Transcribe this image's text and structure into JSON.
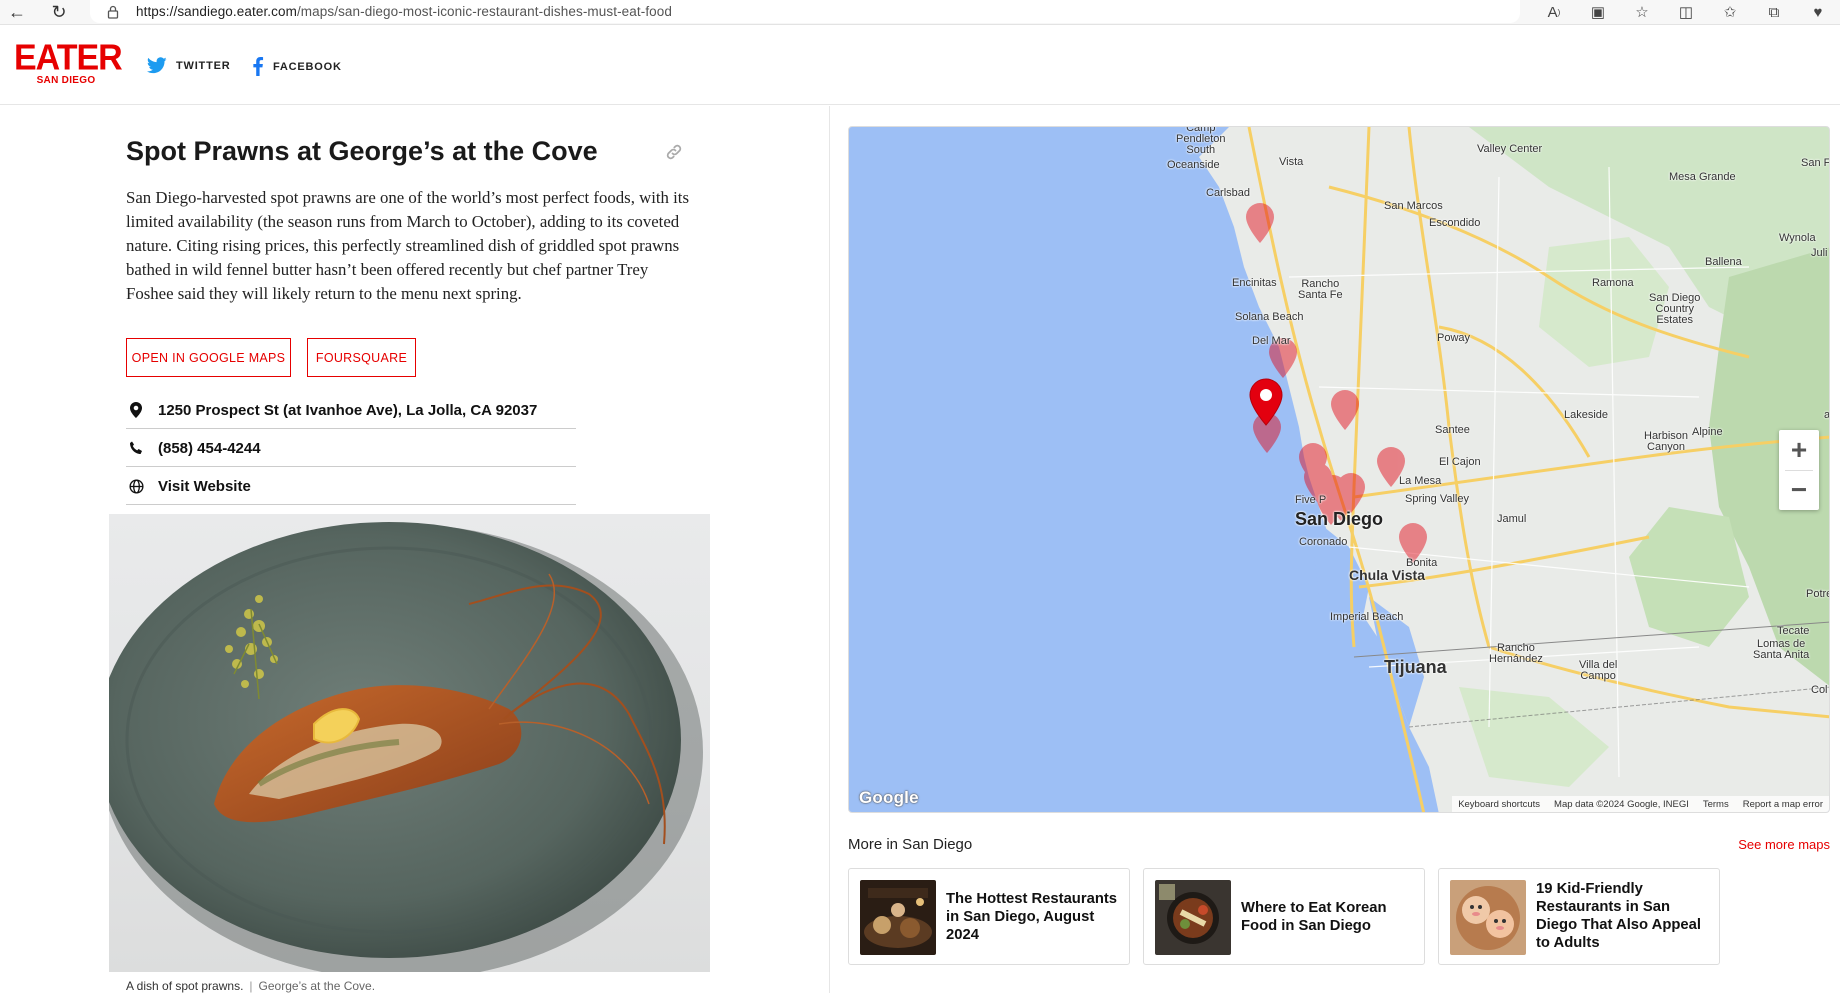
{
  "browser": {
    "url_host": "https://sandiego.eater.com",
    "url_path": "/maps/san-diego-most-iconic-restaurant-dishes-must-eat-food"
  },
  "header": {
    "logo_main": "EATER",
    "logo_sub": "SAN DIEGO",
    "twitter_label": "TWITTER",
    "facebook_label": "FACEBOOK"
  },
  "place": {
    "title": "Spot Prawns at George’s at the Cove",
    "description": "San Diego-harvested spot prawns are one of the world’s most perfect foods, with its limited availability (the season runs from March to October), adding to its coveted nature. Citing rising prices, this perfectly streamlined dish of griddled spot prawns bathed in wild fennel butter hasn’t been offered recently but chef partner Trey Foshee said they will likely return to the menu next spring.",
    "google_maps_button": "OPEN IN GOOGLE MAPS",
    "foursquare_button": "FOURSQUARE",
    "address": "1250 Prospect St (at Ivanhoe Ave), La Jolla, CA 92037",
    "phone": "(858) 454-4244",
    "website_label": "Visit Website",
    "caption": "A dish of spot prawns.",
    "caption_sep": "|",
    "caption_credit": "George’s at the Cove."
  },
  "map": {
    "labels": {
      "camp_pendleton": "Camp\nPendleton\nSouth",
      "oceanside": "Oceanside",
      "vista": "Vista",
      "valley_center": "Valley Center",
      "san_f": "San F",
      "mesa_grande": "Mesa Grande",
      "carlsbad": "Carlsbad",
      "san_marcos": "San Marcos",
      "escondido": "Escondido",
      "wynola": "Wynola",
      "juli": "Juli",
      "ballena": "Ballena",
      "encinitas": "Encinitas",
      "rancho_santa_fe": "Rancho\nSanta Fe",
      "ramona": "Ramona",
      "san_diego_cce": "San Diego\nCountry\nEstates",
      "solana_beach": "Solana Beach",
      "poway": "Poway",
      "del_mar": "Del Mar",
      "lakeside": "Lakeside",
      "santee": "Santee",
      "harbison_canyon": "Harbison\nCanyon",
      "alpine": "Alpine",
      "el_cajon": "El Cajon",
      "la_mesa": "La Mesa",
      "spring_valley": "Spring Valley",
      "five_points": "Five P",
      "san_diego": "San Diego",
      "coronado": "Coronado",
      "jamul": "Jamul",
      "bonita": "Bonita",
      "chula_vista": "Chula Vista",
      "potrero": "Potre",
      "imperial_beach": "Imperial Beach",
      "tecate": "Tecate",
      "lomas_santa_anita": "Lomas de\nSanta Anita",
      "rancho_hernandez": "Rancho\nHernández",
      "tijuana": "Tijuana",
      "villa_campo": "Villa del\nCampo",
      "col": "Col",
      "ar": "ar"
    },
    "google_logo": "Google",
    "footer": [
      "Keyboard shortcuts",
      "Map data ©2024 Google, INEGI",
      "Terms",
      "Report a map error"
    ],
    "zoom_in": "+",
    "zoom_out": "−",
    "marker_color": "#e3000f"
  },
  "more": {
    "title": "More in San Diego",
    "see_more": "See more maps",
    "cards": [
      {
        "title": "The Hottest Restaurants in San Diego, August 2024"
      },
      {
        "title": "Where to Eat Korean Food in San Diego"
      },
      {
        "title": "19 Kid-Friendly Restaurants in San Diego That Also Appeal to Adults"
      }
    ]
  },
  "colors": {
    "brand": "#e60000",
    "water": "#9dbff5",
    "land": "#e8eae6",
    "park": "#c8e3bf"
  }
}
